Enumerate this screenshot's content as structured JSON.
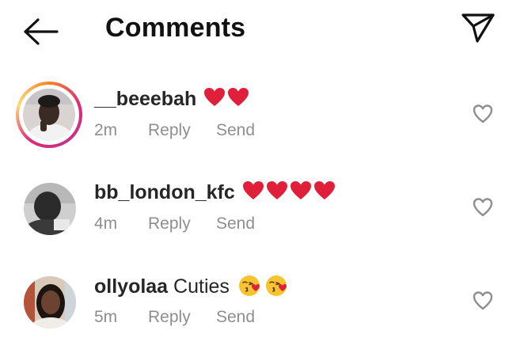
{
  "header": {
    "title": "Comments",
    "back_icon": "arrow-left-icon",
    "action_icon": "paper-plane-icon"
  },
  "colors": {
    "text": "#262626",
    "meta": "#8e8e8e",
    "heart": "#e0203a",
    "story_ring": [
      "#f58529",
      "#dd2a7b",
      "#c13584",
      "#feda77"
    ]
  },
  "comments": [
    {
      "username": "__beeebah",
      "text": "",
      "emoji": [
        "red-heart",
        "red-heart"
      ],
      "time": "2m",
      "reply_label": "Reply",
      "send_label": "Send",
      "has_story_ring": true
    },
    {
      "username": "bb_london_kfc",
      "text": "",
      "emoji": [
        "red-heart",
        "red-heart",
        "red-heart",
        "red-heart"
      ],
      "time": "4m",
      "reply_label": "Reply",
      "send_label": "Send",
      "has_story_ring": false
    },
    {
      "username": "ollyolaa",
      "text": "Cuties",
      "emoji": [
        "face-blowing-kiss",
        "face-blowing-kiss"
      ],
      "time": "5m",
      "reply_label": "Reply",
      "send_label": "Send",
      "has_story_ring": false
    }
  ]
}
